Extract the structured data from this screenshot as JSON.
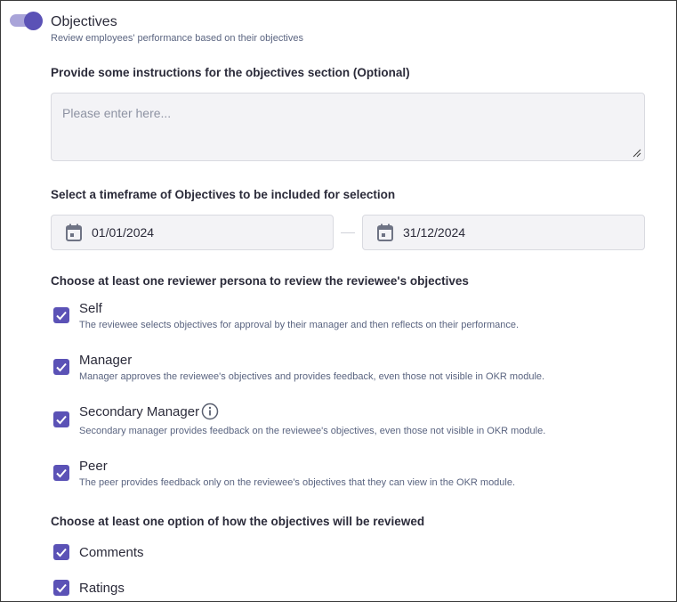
{
  "section": {
    "title": "Objectives",
    "subtitle": "Review employees' performance based on their objectives",
    "enabled": true
  },
  "instructions": {
    "label": "Provide some instructions for the objectives section (Optional)",
    "placeholder": "Please enter here...",
    "value": ""
  },
  "timeframe": {
    "label": "Select a timeframe of Objectives to be included for selection",
    "start": "01/01/2024",
    "end": "31/12/2024"
  },
  "personas": {
    "label": "Choose at least one reviewer persona to review the reviewee's objectives",
    "items": [
      {
        "title": "Self",
        "desc": "The reviewee selects objectives for approval by their manager and then reflects on their performance.",
        "checked": true
      },
      {
        "title": "Manager",
        "desc": "Manager approves the reviewee's objectives and provides feedback, even those not visible in OKR module.",
        "checked": true
      },
      {
        "title": "Secondary Manager",
        "desc": "Secondary manager provides feedback on the reviewee's objectives, even those not visible in OKR module.",
        "checked": true
      },
      {
        "title": "Peer",
        "desc": "The peer provides feedback only on the reviewee's objectives that they can view in the OKR module.",
        "checked": true
      }
    ]
  },
  "review_options": {
    "label": "Choose at least one option of how the objectives will be reviewed",
    "items": [
      {
        "title": "Comments",
        "checked": true
      },
      {
        "title": "Ratings",
        "checked": true
      }
    ]
  },
  "colors": {
    "accent": "#5b52b6",
    "toggle_track": "#a9a4d9",
    "field_bg": "#f3f3f6",
    "muted_text": "#5a6480"
  }
}
